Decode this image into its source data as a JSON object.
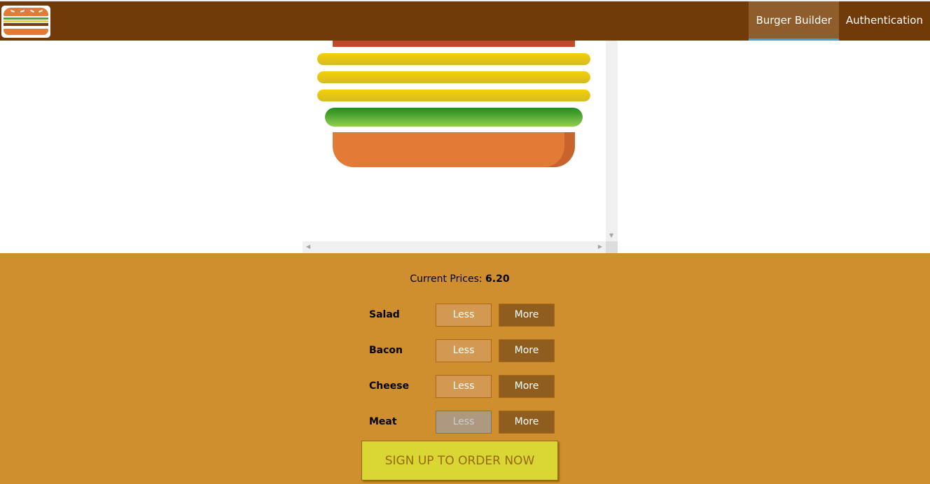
{
  "nav": {
    "items": [
      {
        "label": "Burger Builder",
        "active": true
      },
      {
        "label": "Authentication",
        "active": false
      }
    ]
  },
  "burger": {
    "visible_layers": [
      "meat",
      "cheese",
      "cheese",
      "cheese",
      "salad",
      "bread-bottom"
    ]
  },
  "controls": {
    "price_label": "Current Prices:",
    "price_value": "6.20",
    "ingredients": [
      {
        "label": "Salad",
        "less": "Less",
        "more": "More",
        "less_disabled": false
      },
      {
        "label": "Bacon",
        "less": "Less",
        "more": "More",
        "less_disabled": false
      },
      {
        "label": "Cheese",
        "less": "Less",
        "more": "More",
        "less_disabled": false
      },
      {
        "label": "Meat",
        "less": "Less",
        "more": "More",
        "less_disabled": true
      }
    ],
    "order_button": "SIGN UP TO ORDER NOW"
  },
  "colors": {
    "toolbar": "#703b09",
    "controls_bg": "#cf8f2e",
    "active_underline": "#40a4c8",
    "order_button": "#dad735"
  }
}
